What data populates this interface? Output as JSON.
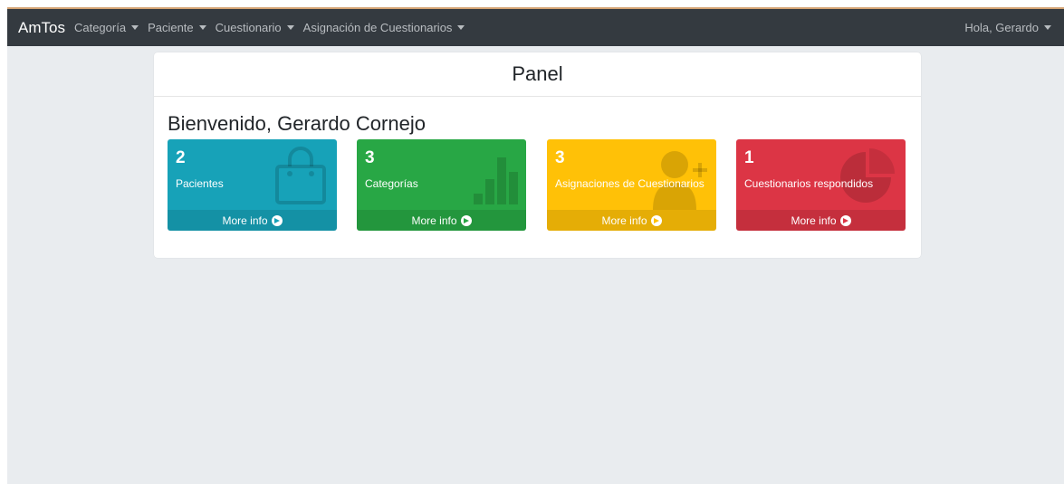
{
  "navbar": {
    "brand": "AmTos",
    "items": [
      {
        "label": "Categoría"
      },
      {
        "label": "Paciente"
      },
      {
        "label": "Cuestionario"
      },
      {
        "label": "Asignación de Cuestionarios"
      }
    ],
    "user": "Hola, Gerardo"
  },
  "panel": {
    "title": "Panel",
    "welcome": "Bienvenido, Gerardo Cornejo"
  },
  "boxes": [
    {
      "count": "2",
      "label": "Pacientes",
      "footer": "More info",
      "icon": "shopping-bag-icon",
      "color": "#17a2b8"
    },
    {
      "count": "3",
      "label": "Categorías",
      "footer": "More info",
      "icon": "bar-chart-icon",
      "color": "#28a745"
    },
    {
      "count": "3",
      "label": "Asignaciones de Cuestionarios",
      "footer": "More info",
      "icon": "user-plus-icon",
      "color": "#ffc107"
    },
    {
      "count": "1",
      "label": "Cuestionarios respondidos",
      "footer": "More info",
      "icon": "pie-chart-icon",
      "color": "#dc3545"
    }
  ]
}
